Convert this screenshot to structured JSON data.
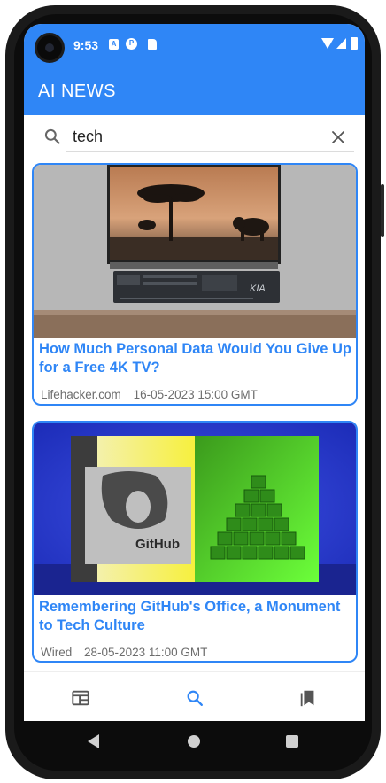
{
  "status_bar": {
    "time": "9:53",
    "icons": [
      "notification-a-icon",
      "notification-p-icon",
      "sd-card-icon",
      "wifi-icon",
      "signal-icon",
      "battery-icon"
    ],
    "a_label": "A",
    "p_label": "P"
  },
  "app_bar": {
    "title": "AI NEWS"
  },
  "search": {
    "value": "tech",
    "placeholder": ""
  },
  "articles": [
    {
      "title": "How Much Personal Data Would You Give Up for a Free 4K TV?",
      "source": "Lifehacker.com",
      "date": "16-05-2023 15:00 GMT",
      "image_desc": "tv-sunset-elephants-image",
      "brand_text": "KIA"
    },
    {
      "title": "Remembering GitHub's Office, a Monument to Tech Culture",
      "source": "Wired",
      "date": "28-05-2023 11:00 GMT",
      "image_desc": "github-office-image",
      "brand_text": "GitHub"
    }
  ],
  "bottom_nav": {
    "items": [
      "headlines-icon",
      "search-icon",
      "bookmarks-icon"
    ],
    "active": 1
  },
  "colors": {
    "primary": "#2f86f6",
    "meta_text": "#6d6d6d",
    "nav_inactive": "#555555"
  }
}
